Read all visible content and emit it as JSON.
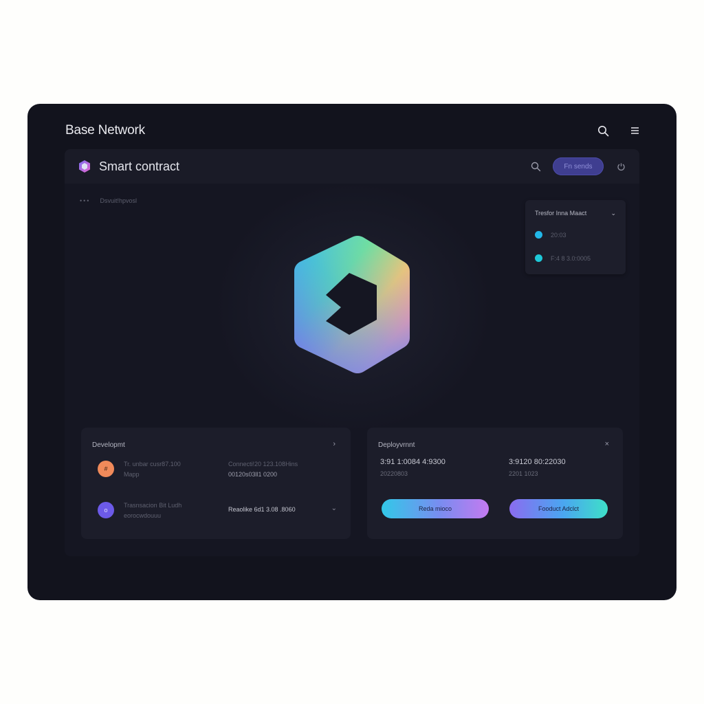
{
  "window": {
    "title": "Base Network"
  },
  "header": {
    "title": "Smart contract",
    "action_label": "Fn sends"
  },
  "breadcrumb": {
    "dots": "•••",
    "label": "Dsvuit!hpvosl"
  },
  "float_card": {
    "title": "Tresfor Inna Maact",
    "items": [
      {
        "label": "20:03",
        "color": "#22b7e8"
      },
      {
        "label": "F:4 8 3.0:0005",
        "color": "#1ec8d8"
      }
    ]
  },
  "left_card": {
    "title": "Developmt",
    "rows": [
      {
        "avatar_color": "#f08a5a",
        "avatar_glyph": "#",
        "line1": "Tr. unbar cusr87.100",
        "line2": "Mapp",
        "b1": "Connecti!20 123.108Hins",
        "b2": "00120s03ll1 0200"
      },
      {
        "avatar_color": "#6c5ae8",
        "avatar_glyph": "o",
        "line1": "Trasnsacion Bit Ludh",
        "line2": "eorocwdouuu",
        "b1": "Reaolike 6d1 3.08 .8060",
        "b2": ""
      }
    ]
  },
  "right_card": {
    "title": "Deployvrnnt",
    "values": [
      {
        "main": "3:91 1:0084 4:9300",
        "sub": "20220803"
      },
      {
        "main": "3:9120 80:22030",
        "sub": "2201 1023"
      }
    ],
    "buttons": [
      "Reda mioco",
      "Fooduct Adclct"
    ]
  },
  "colors": {
    "window_bg": "#12131d",
    "panel_bg": "#151622",
    "accent": "#3f3e90"
  }
}
